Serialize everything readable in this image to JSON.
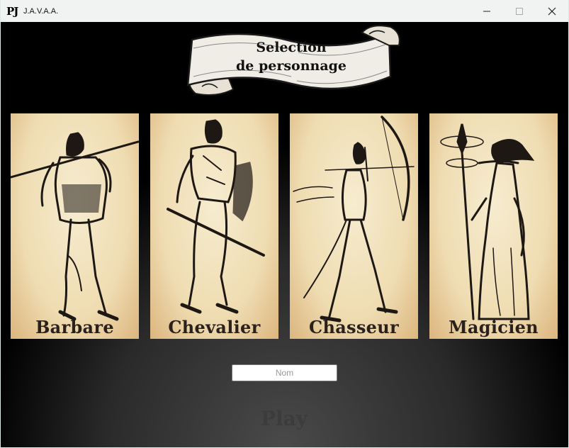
{
  "window": {
    "logo": "PJ",
    "title": "J.A.V.A.A.",
    "controls": [
      "minimize-icon",
      "maximize-icon",
      "close-icon"
    ]
  },
  "header": {
    "banner_line1": "Selection",
    "banner_line2": "de personnage"
  },
  "characters": [
    {
      "label": "Barbare"
    },
    {
      "label": "Chevalier"
    },
    {
      "label": "Chasseur"
    },
    {
      "label": "Magicien"
    }
  ],
  "name_field": {
    "placeholder": "Nom",
    "value": ""
  },
  "play_label": "Play",
  "colors": {
    "parchment": "#efdcb1",
    "ink": "#2a211c",
    "background": "#000000",
    "titlebar": "#f0f3f2"
  }
}
